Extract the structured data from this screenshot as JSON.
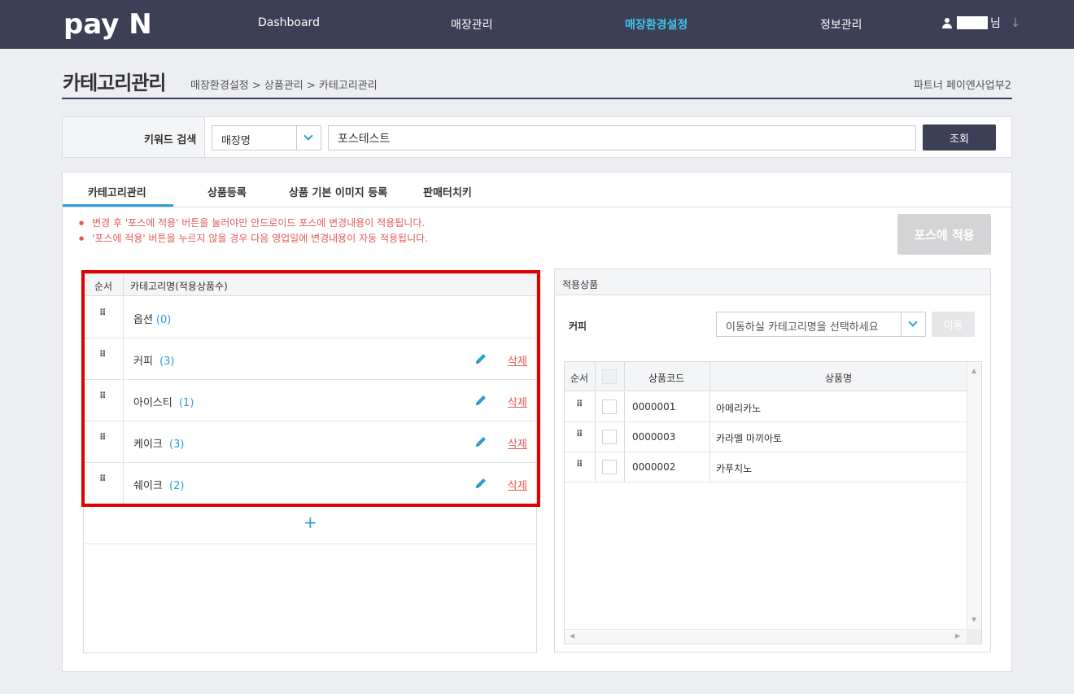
{
  "nav": {
    "logo": "pay N",
    "items": [
      "Dashboard",
      "매장관리",
      "매장환경설정",
      "정보관리"
    ],
    "active_index": 2,
    "user_suffix": "님"
  },
  "header": {
    "title": "카테고리관리",
    "breadcrumb": "매장환경설정 > 상품관리 > 카테고리관리",
    "partner": "파트너 페이엔사업부2"
  },
  "search": {
    "label": "키워드 검색",
    "select_value": "매장명",
    "keyword_value": "포스테스트",
    "button_label": "조회"
  },
  "tabs": [
    "카테고리관리",
    "상품등록",
    "상품 기본 이미지 등록",
    "판매터치키"
  ],
  "notices": [
    "변경 후 '포스에 적용' 버튼을 눌러야만 안드로이드 포스에 변경내용이 적용됩니다.",
    "'포스에 적용' 버튼을 누르지 않을 경우 다음 영업일에 변경내용이 자동 적용됩니다."
  ],
  "apply_button": "포스에 적용",
  "category_panel": {
    "col_order": "순서",
    "col_name": "카테고리명(적용상품수)",
    "delete_label": "삭제",
    "add_label": "+",
    "rows": [
      {
        "name": "옵션",
        "count": "(0)",
        "editable": false
      },
      {
        "name": "커피",
        "count": "(3)",
        "editable": true
      },
      {
        "name": "아이스티",
        "count": "(1)",
        "editable": true
      },
      {
        "name": "케이크",
        "count": "(3)",
        "editable": true
      },
      {
        "name": "쉐이크",
        "count": "(2)",
        "editable": true
      }
    ]
  },
  "product_panel": {
    "title": "적용상품",
    "selected_category": "커피",
    "move_placeholder": "이동하실 카테고리명을 선택하세요",
    "move_button": "이동",
    "col_order": "순서",
    "col_code": "상품코드",
    "col_name": "상품명",
    "rows": [
      {
        "code": "0000001",
        "name": "아메리카노"
      },
      {
        "code": "0000003",
        "name": "카라멜 마끼아토"
      },
      {
        "code": "0000002",
        "name": "카푸치노"
      }
    ]
  },
  "colors": {
    "nav_bg": "#3c3f55",
    "accent": "#2b9fd4",
    "active_nav": "#41c4e6",
    "delete_red": "#e05a5a",
    "highlight_frame": "#e00000"
  }
}
